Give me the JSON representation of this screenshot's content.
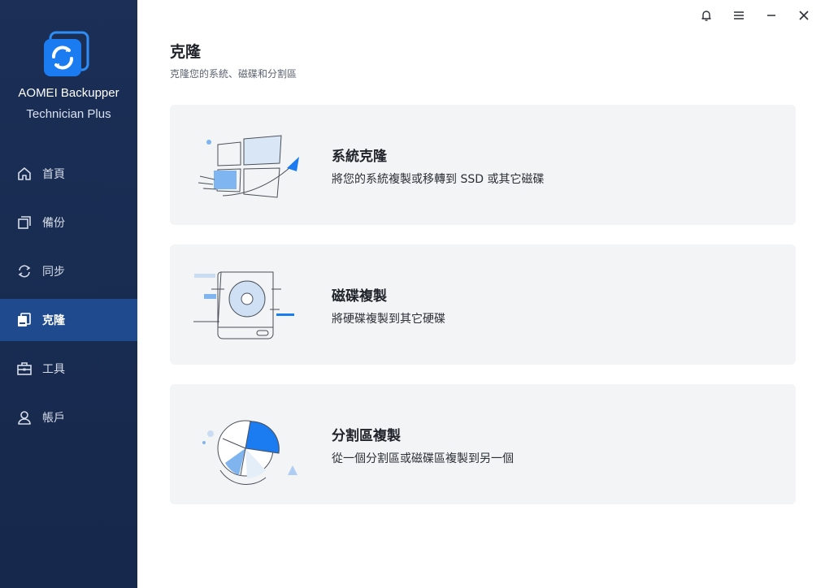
{
  "app": {
    "name": "AOMEI Backupper",
    "edition": "Technician Plus",
    "logo_icon": "aomei-sync-logo-icon"
  },
  "colors": {
    "sidebar_bg": "#1b2f57",
    "sidebar_active": "#1f4b8e",
    "accent": "#1a7cf0",
    "card_bg": "#f3f4f6"
  },
  "sidebar": {
    "items": [
      {
        "label": "首頁",
        "icon": "home-icon",
        "active": false
      },
      {
        "label": "備份",
        "icon": "backup-icon",
        "active": false
      },
      {
        "label": "同步",
        "icon": "sync-icon",
        "active": false
      },
      {
        "label": "克隆",
        "icon": "clone-icon",
        "active": true
      },
      {
        "label": "工具",
        "icon": "toolbox-icon",
        "active": false
      },
      {
        "label": "帳戶",
        "icon": "account-icon",
        "active": false
      }
    ]
  },
  "titlebar": {
    "buttons": [
      "bell-icon",
      "menu-icon",
      "minimize-icon",
      "close-icon"
    ]
  },
  "main": {
    "title": "克隆",
    "subtitle": "克隆您的系統、磁碟和分割區",
    "cards": [
      {
        "title": "系統克隆",
        "desc": "將您的系統複製或移轉到 SSD 或其它磁碟",
        "icon": "system-clone-icon"
      },
      {
        "title": "磁碟複製",
        "desc": "將硬碟複製到其它硬碟",
        "icon": "disk-clone-icon"
      },
      {
        "title": "分割區複製",
        "desc": "從一個分割區或磁碟區複製到另一個",
        "icon": "partition-clone-icon"
      }
    ]
  }
}
